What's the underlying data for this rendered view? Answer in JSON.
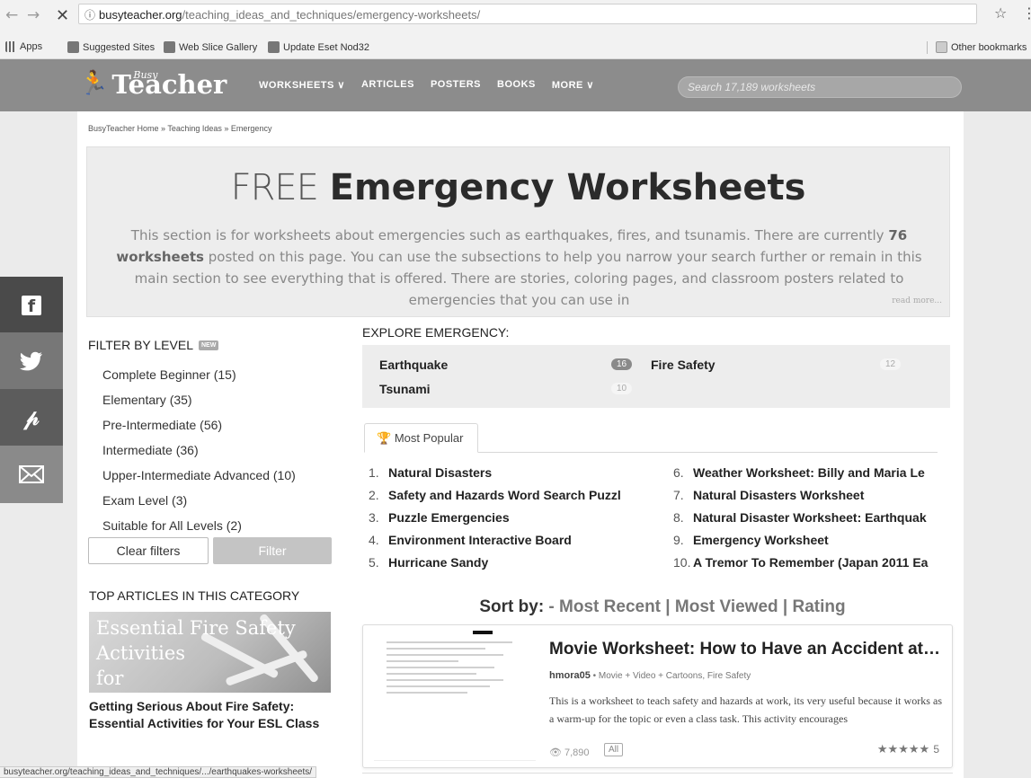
{
  "browser": {
    "back": "←",
    "forward": "→",
    "stop": "✕",
    "info_icon": "ⓘ",
    "url_host": "busyteacher.org",
    "url_path": "/teaching_ideas_and_techniques/emergency-worksheets/",
    "star": "☆",
    "menu": "⋮",
    "bookmarks": [
      "Apps",
      "Suggested Sites",
      "Web Slice Gallery",
      "Update Eset Nod32"
    ],
    "other_bookmarks": "Other bookmarks",
    "status_url": "busyteacher.org/teaching_ideas_and_techniques/.../earthquakes-worksheets/"
  },
  "header": {
    "logo_busy": "Busy",
    "logo_main": "Teacher",
    "nav": [
      "WORKSHEETS ∨",
      "ARTICLES",
      "POSTERS",
      "BOOKS",
      "MORE ∨"
    ],
    "search_placeholder": "Search 17,189 worksheets"
  },
  "breadcrumb": "BusyTeacher Home » Teaching Ideas » Emergency",
  "hero": {
    "title_light": "FREE",
    "title_bold": "Emergency Worksheets",
    "desc_part1": "This section is for worksheets about emergencies such as earthquakes, fires, and tsunamis. There are currently ",
    "desc_bold": "76 worksheets",
    "desc_part2": " posted on this page. You can use the subsections to help you narrow your search further or remain in this main section to see everything that is offered. There are stories, coloring pages, and classroom posters related to emergencies that you can use in",
    "read_more": "read more..."
  },
  "social": {
    "facebook": "f",
    "twitter": "🐦",
    "pinterest": "P",
    "mail": "✉"
  },
  "filter": {
    "title": "FILTER BY LEVEL",
    "badge": "NEW",
    "levels": [
      "Complete Beginner (15)",
      "Elementary (35)",
      "Pre-Intermediate (56)",
      "Intermediate (36)",
      "Upper-Intermediate Advanced (10)",
      "Exam Level (3)",
      "Suitable for All Levels (2)"
    ],
    "clear_label": "Clear filters",
    "filter_label": "Filter"
  },
  "top_articles": {
    "title": "TOP ARTICLES IN THIS CATEGORY",
    "thumb_line1": "Essential Fire Safety",
    "thumb_line2": "Activities",
    "thumb_line3": "for",
    "article_title": "Getting Serious About Fire Safety: Essential Activities for Your ESL Class"
  },
  "explore": {
    "title": "EXPLORE EMERGENCY:",
    "items": [
      {
        "label": "Earthquake",
        "count": "16"
      },
      {
        "label": "Fire Safety",
        "count": "12"
      },
      {
        "label": "Tsunami",
        "count": "10"
      }
    ]
  },
  "popular": {
    "tab": "Most Popular",
    "left": [
      {
        "num": "1.",
        "title": "Natural Disasters"
      },
      {
        "num": "2.",
        "title": "Safety and Hazards Word Search Puzzl"
      },
      {
        "num": "3.",
        "title": "Puzzle Emergencies"
      },
      {
        "num": "4.",
        "title": "Environment Interactive Board"
      },
      {
        "num": "5.",
        "title": "Hurricane Sandy"
      }
    ],
    "right": [
      {
        "num": "6.",
        "title": "Weather Worksheet: Billy and Maria Le"
      },
      {
        "num": "7.",
        "title": "Natural Disasters Worksheet"
      },
      {
        "num": "8.",
        "title": "Natural Disaster Worksheet: Earthquak"
      },
      {
        "num": "9.",
        "title": "Emergency Worksheet"
      },
      {
        "num": "10.",
        "title": "A Tremor To Remember (Japan 2011 Ea"
      }
    ]
  },
  "sort": {
    "label": "Sort by:",
    "prefix": " - ",
    "recent": "Most Recent",
    "sep": " | ",
    "viewed": "Most Viewed",
    "rating": "Rating"
  },
  "card": {
    "title": "Movie Worksheet: How to Have an Accident at Wo...",
    "author": "hmora05",
    "meta": " • Movie + Video + Cartoons, Fire Safety",
    "desc": "This is a worksheet to teach safety and hazards at work, its very useful because it works as a warm-up for the topic or even a class task. This activity encourages",
    "views": "7,890",
    "level_badge": "All",
    "stars": "★★★★★",
    "rating": "5"
  }
}
